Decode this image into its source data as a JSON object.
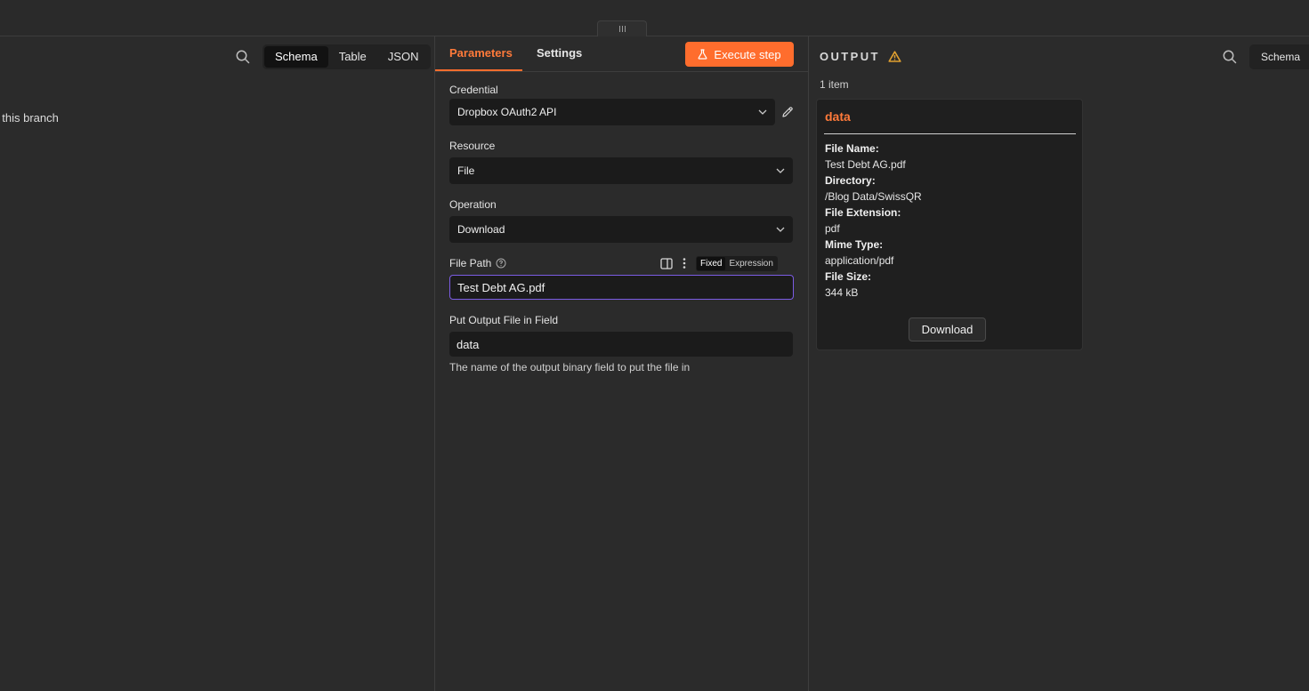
{
  "input_panel": {
    "message_visible": "sent on this branch",
    "view_options": [
      "Schema",
      "Table",
      "JSON"
    ],
    "active_view": "Schema"
  },
  "params_panel": {
    "tabs": [
      {
        "label": "Parameters",
        "active": true
      },
      {
        "label": "Settings",
        "active": false
      }
    ],
    "execute_label": "Execute step",
    "credential": {
      "label": "Credential",
      "value": "Dropbox OAuth2 API"
    },
    "resource": {
      "label": "Resource",
      "value": "File"
    },
    "operation": {
      "label": "Operation",
      "value": "Download"
    },
    "file_path": {
      "label": "File Path",
      "value": "Test Debt AG.pdf",
      "mode_fixed": "Fixed",
      "mode_expression": "Expression"
    },
    "output_field": {
      "label": "Put Output File in Field",
      "value": "data",
      "hint": "The name of the output binary field to put the file in"
    }
  },
  "output_panel": {
    "title": "OUTPUT",
    "view_label": "Schema",
    "item_count": "1 item",
    "card": {
      "title": "data",
      "fields": [
        {
          "key": "File Name:",
          "value": "Test Debt AG.pdf"
        },
        {
          "key": "Directory:",
          "value": "/Blog Data/SwissQR"
        },
        {
          "key": "File Extension:",
          "value": "pdf"
        },
        {
          "key": "Mime Type:",
          "value": "application/pdf"
        },
        {
          "key": "File Size:",
          "value": "344 kB"
        }
      ],
      "download_label": "Download"
    }
  },
  "colors": {
    "accent": "#ff6d2d",
    "focus": "#7c5ce4",
    "background": "#2b2b2b",
    "field_bg": "#1b1b1b",
    "warning": "#e0a030"
  }
}
